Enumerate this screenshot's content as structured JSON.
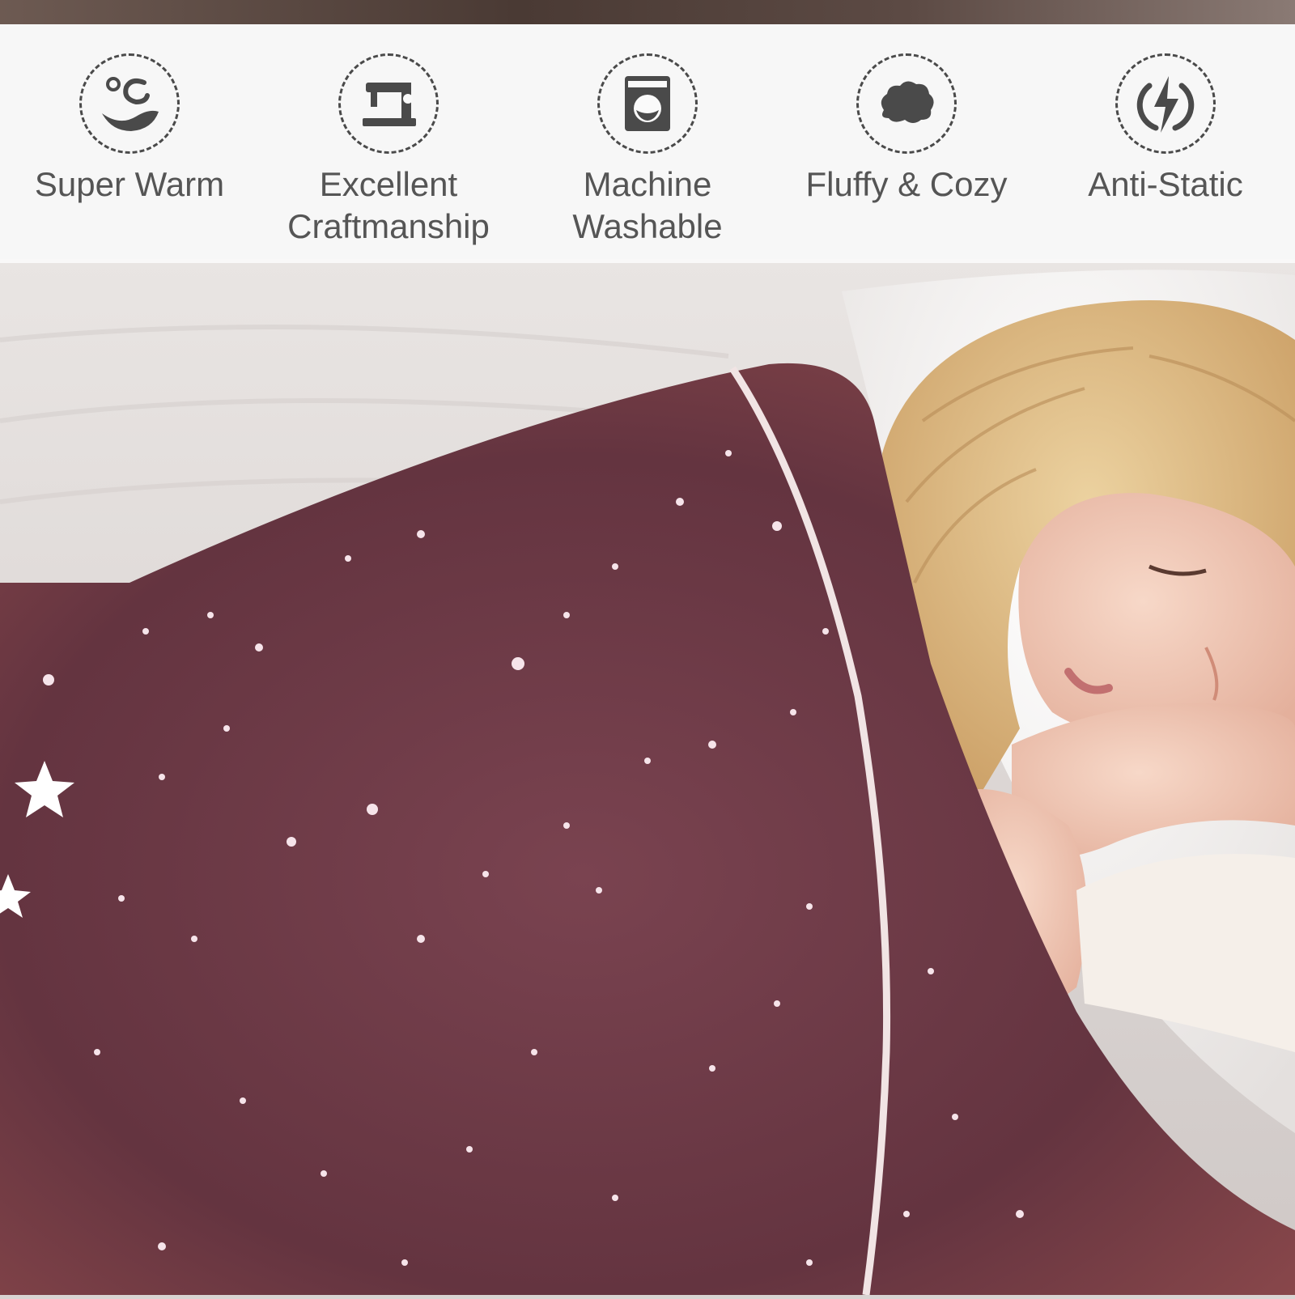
{
  "features": [
    {
      "label": "Super Warm",
      "icon": "warm-temperature-icon"
    },
    {
      "label": "Excellent\nCraftmanship",
      "icon": "sewing-machine-icon"
    },
    {
      "label": "Machine\nWashable",
      "icon": "washing-machine-icon"
    },
    {
      "label": "Fluffy & Cozy",
      "icon": "cloud-icon"
    },
    {
      "label": "Anti-Static",
      "icon": "lightning-icon"
    }
  ],
  "colors": {
    "icon": "#4a4a4a",
    "label": "#555555",
    "blanket": "#6e3a45",
    "hair": "#d9b37c",
    "skin": "#f0c8b4"
  }
}
